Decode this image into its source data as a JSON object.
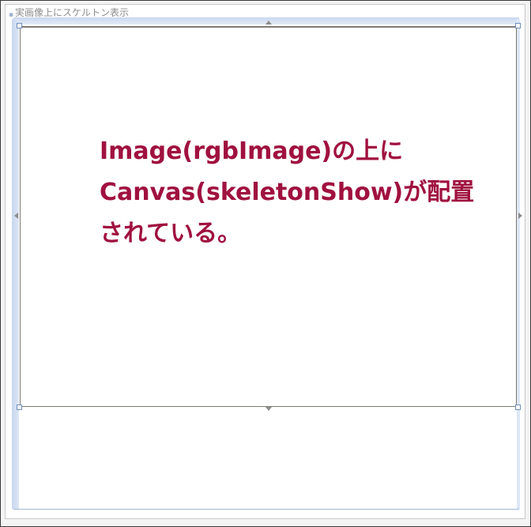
{
  "window": {
    "title": "実画像上にスケルトン表示"
  },
  "canvas_note": {
    "lines": [
      "Image(rgbImage)の上に",
      "Canvas(skeletonShow)が配置",
      "されている。"
    ]
  },
  "colors": {
    "note_text": "#a0113f",
    "rail": "#c6d6ee",
    "canvas_border": "#7f7a73"
  },
  "icons": {
    "resize_up": "arrow-up-icon",
    "resize_down": "arrow-down-icon",
    "resize_left": "arrow-left-icon",
    "resize_right": "arrow-right-icon",
    "window_glyph": "window-corner-icon"
  }
}
